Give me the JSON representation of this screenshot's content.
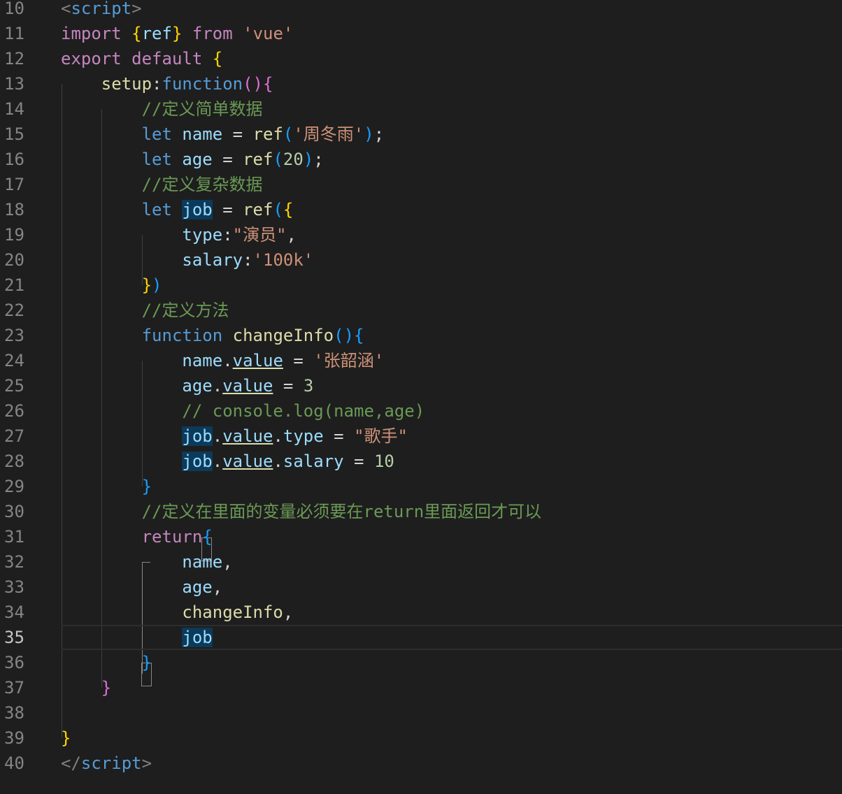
{
  "editor": {
    "lines": [
      {
        "n": "10",
        "parts": [
          [
            "pn",
            "<"
          ],
          [
            "tag",
            "script"
          ],
          [
            "pn",
            ">"
          ]
        ]
      },
      {
        "n": "11",
        "parts": [
          [
            "kw",
            "import "
          ],
          [
            "b1",
            "{"
          ],
          [
            "vr",
            "ref"
          ],
          [
            "b1",
            "}"
          ],
          [
            "kw",
            " from "
          ],
          [
            "str",
            "'vue'"
          ]
        ]
      },
      {
        "n": "12",
        "parts": [
          [
            "kw",
            "export default "
          ],
          [
            "b1",
            "{"
          ]
        ]
      },
      {
        "n": "13",
        "parts": [
          [
            "fn",
            "    setup"
          ],
          [
            "txt",
            ":"
          ],
          [
            "st",
            "function"
          ],
          [
            "b2",
            "()"
          ],
          [
            "b2",
            "{"
          ]
        ]
      },
      {
        "n": "14",
        "parts": [
          [
            "cm",
            "        //定义简单数据"
          ]
        ]
      },
      {
        "n": "15",
        "parts": [
          [
            "st",
            "        let "
          ],
          [
            "vr",
            "name"
          ],
          [
            "txt",
            " = "
          ],
          [
            "fn",
            "ref"
          ],
          [
            "b3",
            "("
          ],
          [
            "str",
            "'周冬雨'"
          ],
          [
            "b3",
            ")"
          ],
          [
            "txt",
            ";"
          ]
        ]
      },
      {
        "n": "16",
        "parts": [
          [
            "st",
            "        let "
          ],
          [
            "vr",
            "age"
          ],
          [
            "txt",
            " = "
          ],
          [
            "fn",
            "ref"
          ],
          [
            "b3",
            "("
          ],
          [
            "num",
            "20"
          ],
          [
            "b3",
            ")"
          ],
          [
            "txt",
            ";"
          ]
        ]
      },
      {
        "n": "17",
        "parts": [
          [
            "cm",
            "        //定义复杂数据"
          ]
        ]
      },
      {
        "n": "18",
        "parts": [
          [
            "st",
            "        let "
          ],
          [
            "vr hl",
            "job"
          ],
          [
            "txt",
            " = "
          ],
          [
            "fn",
            "ref"
          ],
          [
            "b3",
            "("
          ],
          [
            "b1",
            "{"
          ]
        ]
      },
      {
        "n": "19",
        "parts": [
          [
            "vr",
            "            type"
          ],
          [
            "txt",
            ":"
          ],
          [
            "str",
            "\"演员\""
          ],
          [
            "txt",
            ","
          ]
        ]
      },
      {
        "n": "20",
        "parts": [
          [
            "vr",
            "            salary"
          ],
          [
            "txt",
            ":"
          ],
          [
            "str",
            "'100k'"
          ]
        ]
      },
      {
        "n": "21",
        "parts": [
          [
            "b1",
            "        }"
          ],
          [
            "b3",
            ")"
          ]
        ]
      },
      {
        "n": "22",
        "parts": [
          [
            "cm",
            "        //定义方法"
          ]
        ]
      },
      {
        "n": "23",
        "parts": [
          [
            "st",
            "        function "
          ],
          [
            "fn",
            "changeInfo"
          ],
          [
            "b3",
            "()"
          ],
          [
            "b3",
            "{"
          ]
        ]
      },
      {
        "n": "24",
        "parts": [
          [
            "vr",
            "            name"
          ],
          [
            "txt",
            "."
          ],
          [
            "vr ul",
            "value"
          ],
          [
            "txt",
            " = "
          ],
          [
            "str",
            "'张韶涵'"
          ]
        ]
      },
      {
        "n": "25",
        "parts": [
          [
            "vr",
            "            age"
          ],
          [
            "txt",
            "."
          ],
          [
            "vr ul",
            "value"
          ],
          [
            "txt",
            " = "
          ],
          [
            "num",
            "3"
          ]
        ]
      },
      {
        "n": "26",
        "parts": [
          [
            "cm",
            "            // console.log(name,age)"
          ]
        ]
      },
      {
        "n": "27",
        "parts": [
          [
            "txt",
            "            "
          ],
          [
            "vr hl",
            "job"
          ],
          [
            "txt",
            "."
          ],
          [
            "vr ul",
            "value"
          ],
          [
            "txt",
            "."
          ],
          [
            "vr",
            "type"
          ],
          [
            "txt",
            " = "
          ],
          [
            "str",
            "\"歌手\""
          ]
        ]
      },
      {
        "n": "28",
        "parts": [
          [
            "txt",
            "            "
          ],
          [
            "vr hl",
            "job"
          ],
          [
            "txt",
            "."
          ],
          [
            "vr ul",
            "value"
          ],
          [
            "txt",
            "."
          ],
          [
            "vr",
            "salary"
          ],
          [
            "txt",
            " = "
          ],
          [
            "num",
            "10"
          ]
        ]
      },
      {
        "n": "29",
        "parts": [
          [
            "b3",
            "        }"
          ]
        ]
      },
      {
        "n": "30",
        "parts": [
          [
            "cm",
            "        //定义在里面的变量必须要在return里面返回才可以"
          ]
        ]
      },
      {
        "n": "31",
        "parts": [
          [
            "kw",
            "        return"
          ],
          [
            "b3",
            "{"
          ]
        ]
      },
      {
        "n": "32",
        "parts": [
          [
            "vr",
            "            name"
          ],
          [
            "txt",
            ","
          ]
        ]
      },
      {
        "n": "33",
        "parts": [
          [
            "vr",
            "            age"
          ],
          [
            "txt",
            ","
          ]
        ]
      },
      {
        "n": "34",
        "parts": [
          [
            "fn",
            "            changeInfo"
          ],
          [
            "txt",
            ","
          ]
        ]
      },
      {
        "n": "35",
        "parts": [
          [
            "txt",
            "            "
          ],
          [
            "vr hl",
            "job"
          ]
        ]
      },
      {
        "n": "36",
        "parts": [
          [
            "b3",
            "        }"
          ]
        ]
      },
      {
        "n": "37",
        "parts": [
          [
            "b2",
            "    }"
          ]
        ]
      },
      {
        "n": "38",
        "parts": []
      },
      {
        "n": "39",
        "parts": [
          [
            "b1",
            "}"
          ]
        ]
      },
      {
        "n": "40",
        "parts": [
          [
            "pn",
            "</"
          ],
          [
            "tag",
            "script"
          ],
          [
            "pn",
            ">"
          ]
        ]
      }
    ],
    "current_line": "35"
  }
}
